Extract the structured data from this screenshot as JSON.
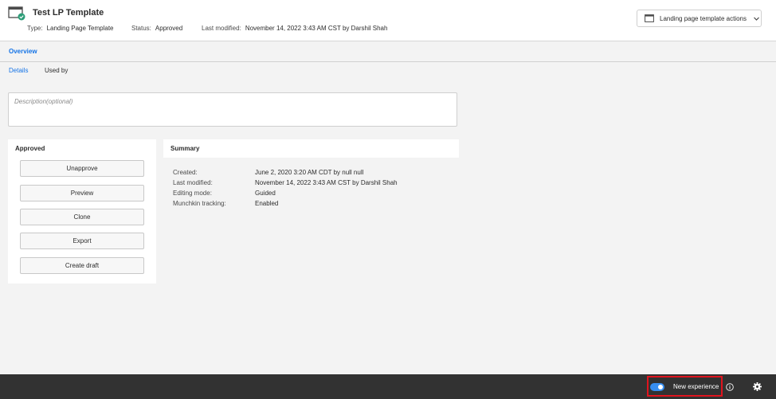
{
  "header": {
    "title": "Test LP Template",
    "type_label": "Type:",
    "type_value": "Landing Page Template",
    "status_label": "Status:",
    "status_value": "Approved",
    "modified_label": "Last modified:",
    "modified_value": "November 14, 2022 3:43 AM CST by Darshil Shah",
    "actions_label": "Landing page template actions",
    "page_icon": "landing-page-approved-icon"
  },
  "tabs": {
    "overview": "Overview",
    "details": "Details",
    "used_by": "Used by"
  },
  "description": {
    "placeholder": "Description(optional)"
  },
  "approved_panel": {
    "heading": "Approved",
    "buttons": [
      "Unapprove",
      "Preview",
      "Clone",
      "Export",
      "Create draft"
    ]
  },
  "summary": {
    "heading": "Summary",
    "rows": [
      {
        "label": "Created:",
        "value": "June 2, 2020 3:20 AM CDT by null null"
      },
      {
        "label": "Last modified:",
        "value": "November 14, 2022 3:43 AM CST by Darshil Shah"
      },
      {
        "label": "Editing mode:",
        "value": "Guided"
      },
      {
        "label": "Munchkin tracking:",
        "value": "Enabled"
      }
    ]
  },
  "footer": {
    "toggle_on": true,
    "new_experience_label": "New experience",
    "icons": [
      "info-icon",
      "gear-icon"
    ]
  },
  "colors": {
    "accent": "#1473e6",
    "footer_bg": "#323232",
    "highlight_border": "#e0141e",
    "toggle": "#378ef0"
  }
}
